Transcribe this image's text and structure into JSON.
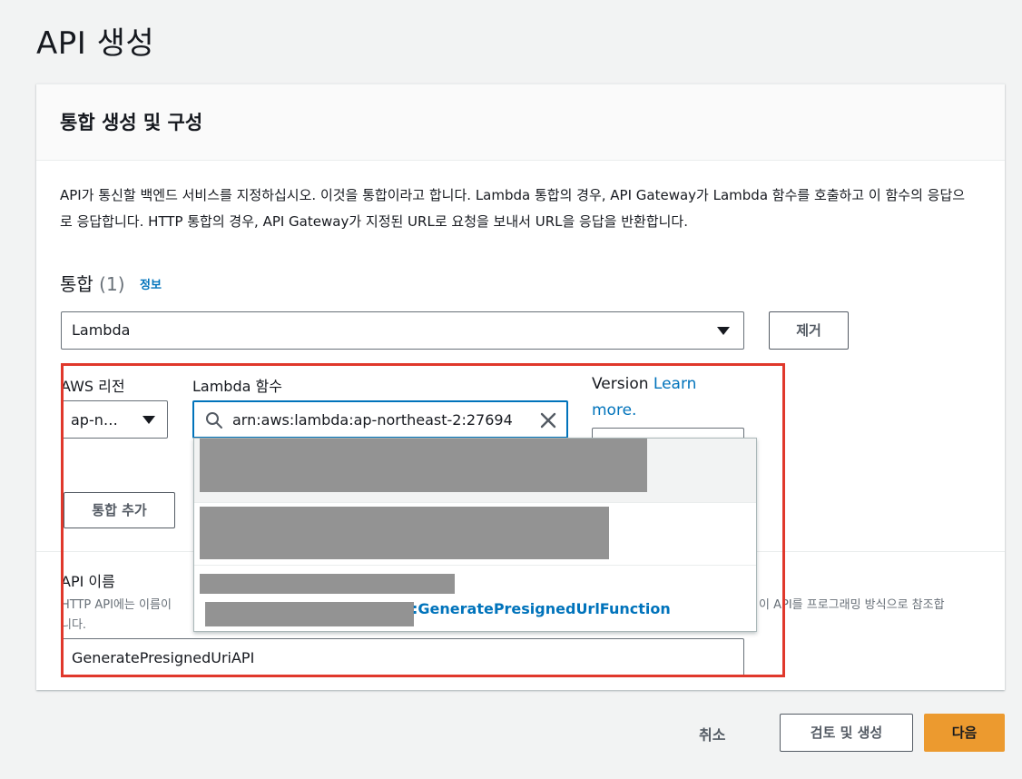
{
  "page": {
    "title": "API 생성"
  },
  "panel": {
    "title": "통합 생성 및 구성",
    "description": "API가 통신할 백엔드 서비스를 지정하십시오. 이것을 통합이라고 합니다. Lambda 통합의 경우, API Gateway가 Lambda 함수를 호출하고 이 함수의 응답으로 응답합니다. HTTP 통합의 경우, API Gateway가 지정된 URL로 요청을 보내서 URL을 응답을 반환합니다."
  },
  "integrations": {
    "heading": "통합",
    "count": "(1)",
    "info_link": "정보",
    "type_value": "Lambda",
    "remove_label": "제거",
    "region_label": "AWS 리전",
    "region_value": "ap-n…",
    "lambda_label": "Lambda 함수",
    "lambda_value": "arn:aws:lambda:ap-northeast-2:27694",
    "version_label": "Version",
    "version_link": "Learn more.",
    "add_label": "통합 추가"
  },
  "dropdown": {
    "highlighted_match": ":GeneratePresignedUrlFunction"
  },
  "api_name": {
    "label": "API 이름",
    "desc_start": "HTTP API에는 이름이",
    "desc_end": "이 API를 프로그래밍 방식으로 참조합",
    "desc_wrap": "니다.",
    "value": "GeneratePresignedUriAPI"
  },
  "footer": {
    "cancel_label": "취소",
    "review_label": "검토 및 생성",
    "next_label": "다음"
  },
  "colors": {
    "accent": "#0073bb",
    "primary_button": "#ec9a2f",
    "highlight": "#e0382b"
  }
}
